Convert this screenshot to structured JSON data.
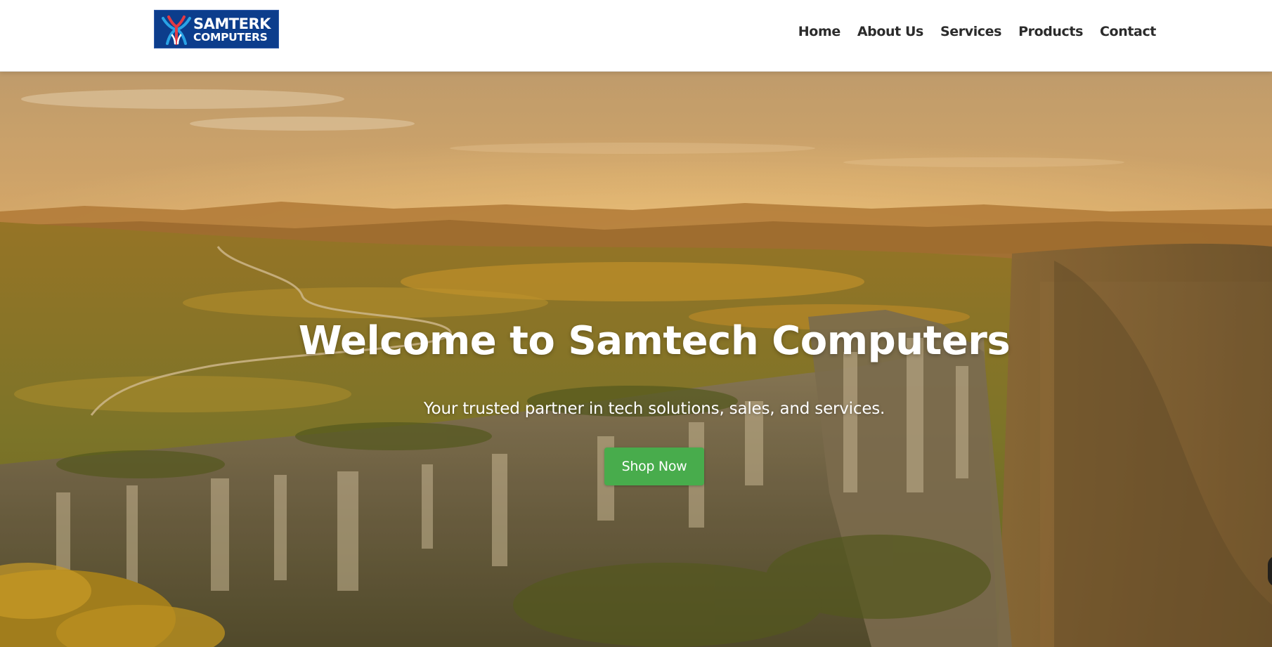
{
  "header": {
    "logo": {
      "line1": "SAMTERK",
      "line2": "COMPUTERS",
      "background_color": "#0c3d8c"
    },
    "nav": [
      {
        "label": "Home"
      },
      {
        "label": "About Us"
      },
      {
        "label": "Services"
      },
      {
        "label": "Products"
      },
      {
        "label": "Contact"
      }
    ]
  },
  "hero": {
    "title": "Welcome to Samtech Computers",
    "subtitle": "Your trusted partner in tech solutions, sales, and services.",
    "cta_label": "Shop Now",
    "cta_color": "#48ac4c",
    "background_image": "landscape-sunset-cliffs"
  }
}
